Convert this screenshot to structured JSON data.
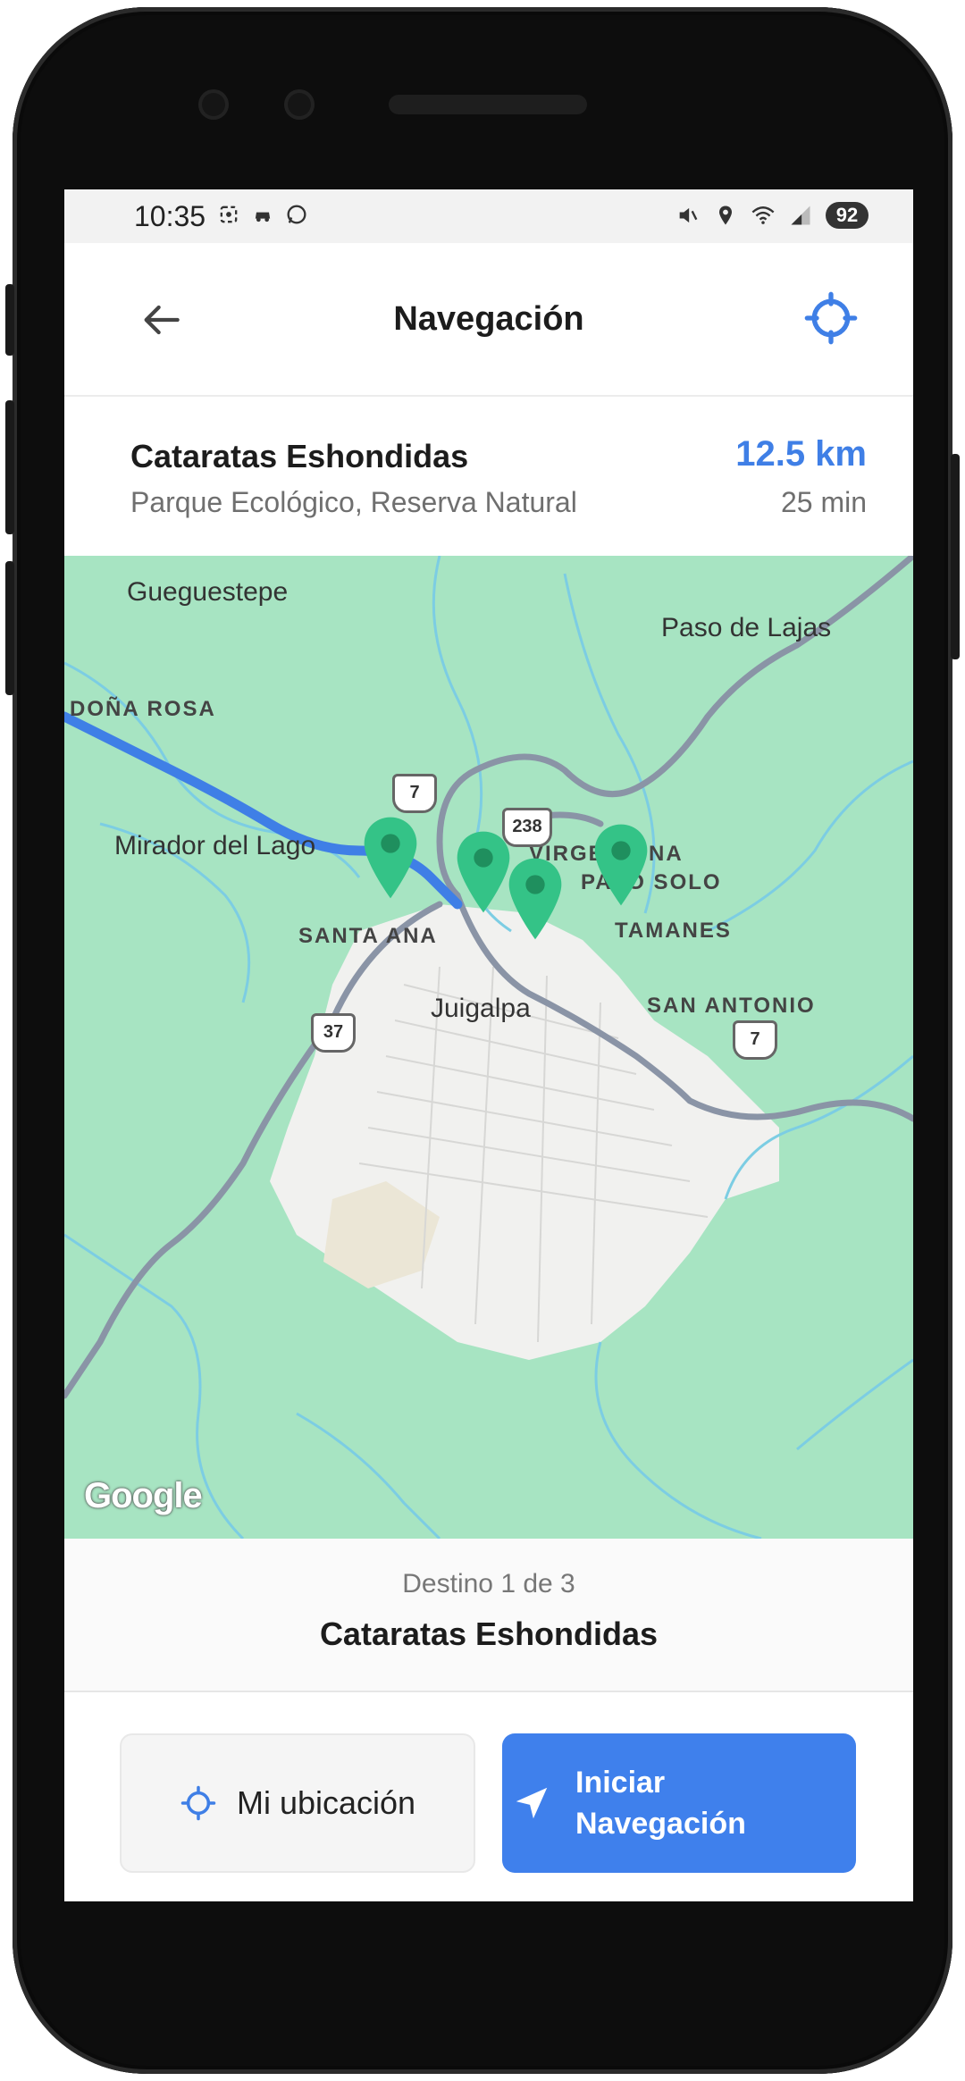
{
  "status_bar": {
    "time": "10:35",
    "battery": "92",
    "left_icons": [
      "screenshot-icon",
      "car-icon",
      "whatsapp-icon"
    ],
    "right_icons": [
      "mute-icon",
      "location-icon",
      "wifi-icon",
      "signal-icon"
    ]
  },
  "header": {
    "title": "Navegación",
    "back_icon": "arrow-left-icon",
    "action_icon": "crosshair-icon",
    "accent_color": "#3f7fe6"
  },
  "destination": {
    "name": "Cataratas Eshondidas",
    "subtitle": "Parque Ecológico, Reserva Natural",
    "distance": "12.5 km",
    "duration": "25 min"
  },
  "map": {
    "labels": {
      "gueguestepe": "Gueguestepe",
      "paso_de_lajas": "Paso de Lajas",
      "dona_rosa": "DOÑA ROSA",
      "mirador": "Mirador del Lago",
      "virgen": "VIRGEN",
      "virgen_b": "NA",
      "palo_solo": "PALO SOLO",
      "santa_ana": "SANTA ANA",
      "tamanes": "TAMANES",
      "juigalpa": "Juigalpa",
      "san_antonio": "SAN ANTONIO"
    },
    "shields": {
      "r7_top": "7",
      "r238": "238",
      "r37": "37",
      "r7_right": "7"
    },
    "attribution": "Google",
    "pin_color": "#34c387",
    "route_color": "#3f7fe6"
  },
  "progress": {
    "count_text": "Destino 1 de 3",
    "current_destination": "Cataratas Eshondidas"
  },
  "actions": {
    "my_location_label": "Mi ubicación",
    "my_location_icon": "crosshair-icon",
    "start_label": "Iniciar Navegación",
    "start_icon": "navigation-arrow-icon",
    "start_color": "#3f80ec"
  }
}
